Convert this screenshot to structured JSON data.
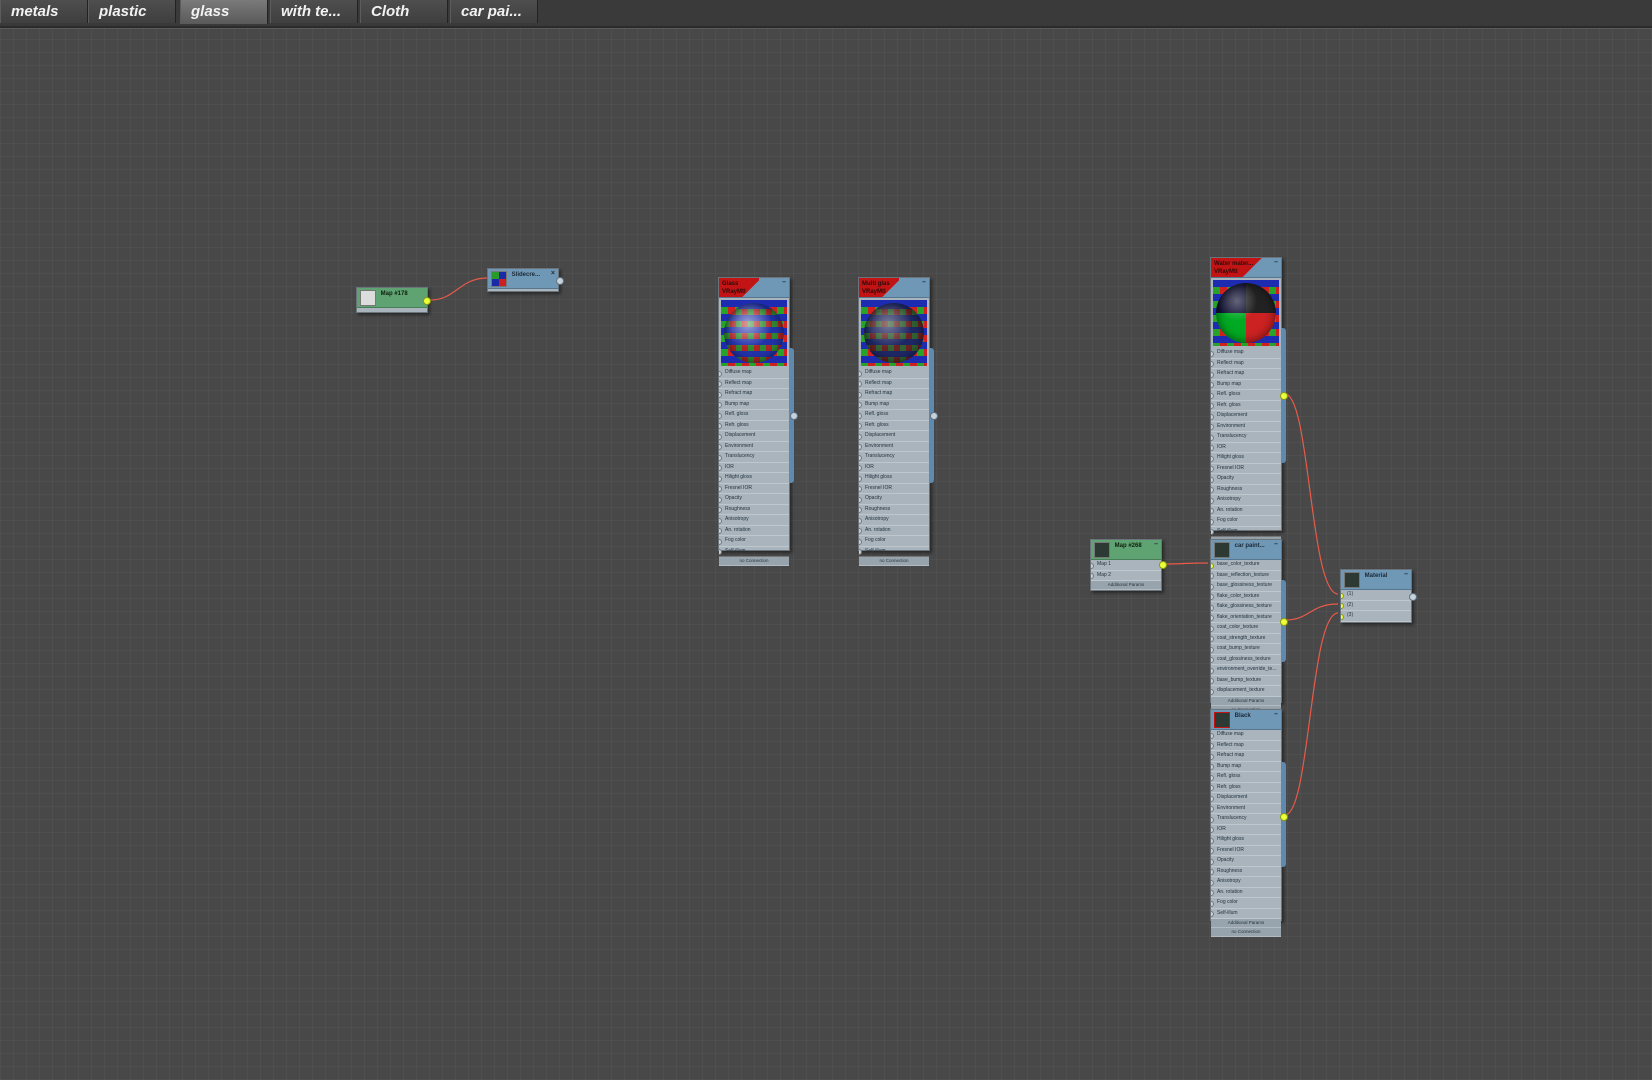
{
  "tabs": [
    {
      "label": "metals",
      "active": false
    },
    {
      "label": "plastic",
      "active": false
    },
    {
      "label": "glass",
      "active": true
    },
    {
      "label": "with te...",
      "active": false
    },
    {
      "label": "Cloth",
      "active": false
    },
    {
      "label": "car pai...",
      "active": false
    }
  ],
  "colors": {
    "wire": "#e85a4a",
    "socket_lit": "#eaff3a",
    "header_blue": "#6f97b6",
    "header_green": "#5fa372",
    "header_red": "#c21414"
  },
  "nodes": {
    "map178": {
      "title": "Map #178",
      "type": "Bitmap"
    },
    "slidecar": {
      "title": "Slidecre...",
      "type": "VRayMtl"
    },
    "glass1": {
      "title": "Glass",
      "type": "VRayMtl"
    },
    "glass2": {
      "title": "Multi glas",
      "type": "VRayMtl"
    },
    "water": {
      "title": "Water mater...",
      "type": "VRayMtl"
    },
    "map268": {
      "title": "Map #268",
      "type": "Falloff"
    },
    "carpaint": {
      "title": "car paint...",
      "type": "VRayCarP..."
    },
    "black": {
      "title": "Black mat...",
      "type": "VRayMtl"
    },
    "multi": {
      "title": "Material #...",
      "type": "Multi/Sub ..."
    }
  },
  "vray_slots": [
    "Diffuse map",
    "Reflect map",
    "Refract map",
    "Bump map",
    "Refl. gloss",
    "Refr. gloss",
    "Displacement",
    "Environment",
    "Translucency",
    "IOR",
    "Hilight gloss",
    "Fresnel IOR",
    "Opacity",
    "Roughness",
    "Anisotropy",
    "An. rotation",
    "Fog color",
    "Self-illum"
  ],
  "carpaint_slots": [
    "base_color_texture",
    "base_reflection_texture",
    "base_glossiness_texture",
    "flake_color_texture",
    "flake_glossiness_texture",
    "flake_orientation_texture",
    "coat_color_texture",
    "coat_strength_texture",
    "coat_bump_texture",
    "coat_glossiness_texture",
    "environment_override_te...",
    "base_bump_texture",
    "displacement_texture"
  ],
  "falloff_slots": [
    "Map 1",
    "Map 2"
  ],
  "multi_slots": [
    "(1)",
    "(2)",
    "(3)"
  ],
  "labels": {
    "no_connection": "no Connection",
    "additional_params": "Additional Params"
  }
}
